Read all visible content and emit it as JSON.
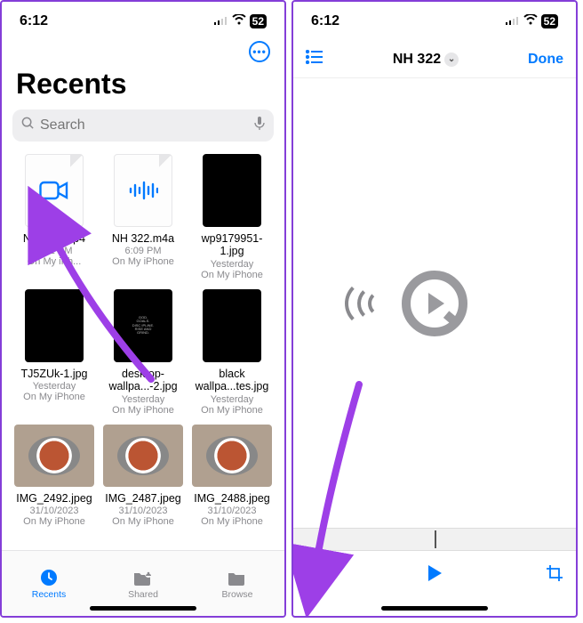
{
  "status": {
    "time": "6:12",
    "battery": "52"
  },
  "left": {
    "heading": "Recents",
    "search_placeholder": "Search",
    "files": [
      {
        "name": "NH 322.mp4",
        "sub": "6:12 PM",
        "loc": "On My iPh...",
        "kind": "doc-video"
      },
      {
        "name": "NH 322.m4a",
        "sub": "6:09 PM",
        "loc": "On My iPhone",
        "kind": "doc-audio"
      },
      {
        "name": "wp9179951-1.jpg",
        "sub": "Yesterday",
        "loc": "On My iPhone",
        "kind": "black"
      },
      {
        "name": "TJ5ZUk-1.jpg",
        "sub": "Yesterday",
        "loc": "On My iPhone",
        "kind": "black"
      },
      {
        "name": "desktop-wallpa...-2.jpg",
        "sub": "Yesterday",
        "loc": "On My iPhone",
        "kind": "black"
      },
      {
        "name": "black wallpa...tes.jpg",
        "sub": "Yesterday",
        "loc": "On My iPhone",
        "kind": "black"
      },
      {
        "name": "IMG_2492.jpeg",
        "sub": "31/10/2023",
        "loc": "On My iPhone",
        "kind": "photo"
      },
      {
        "name": "IMG_2487.jpeg",
        "sub": "31/10/2023",
        "loc": "On My iPhone",
        "kind": "photo"
      },
      {
        "name": "IMG_2488.jpeg",
        "sub": "31/10/2023",
        "loc": "On My iPhone",
        "kind": "photo"
      }
    ],
    "tabs": {
      "recents": "Recents",
      "shared": "Shared",
      "browse": "Browse"
    }
  },
  "right": {
    "title": "NH 322",
    "done": "Done"
  },
  "colors": {
    "accent": "#007aff",
    "muted": "#8a8a8e",
    "annotation": "#9d3fe7"
  }
}
